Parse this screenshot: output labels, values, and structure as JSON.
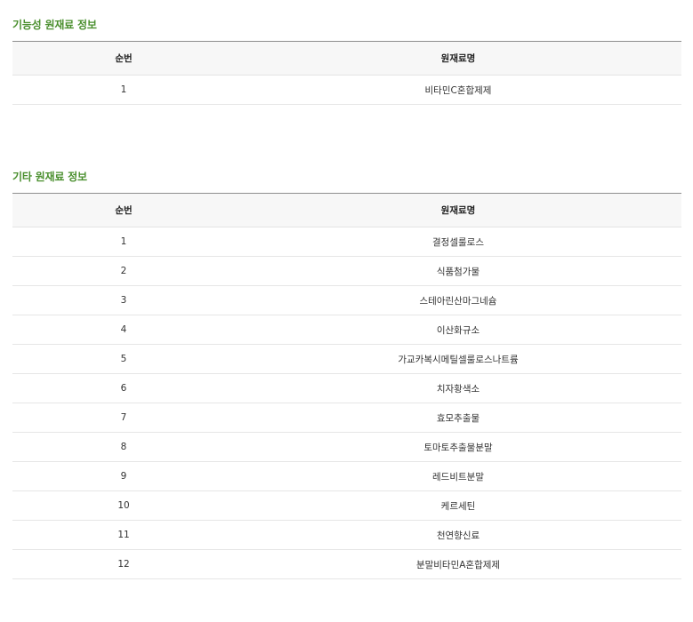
{
  "functional_section": {
    "title": "기능성 원재료 정보",
    "headers": {
      "seq": "순번",
      "name": "원재료명"
    },
    "rows": [
      {
        "seq": "1",
        "name": "비타민C혼합제제"
      }
    ]
  },
  "other_section": {
    "title": "기타 원재료 정보",
    "headers": {
      "seq": "순번",
      "name": "원재료명"
    },
    "rows": [
      {
        "seq": "1",
        "name": "결정셀룰로스"
      },
      {
        "seq": "2",
        "name": "식품첨가물"
      },
      {
        "seq": "3",
        "name": "스테아린산마그네슘"
      },
      {
        "seq": "4",
        "name": "이산화규소"
      },
      {
        "seq": "5",
        "name": "가교카복시메틸셀룰로스나트륨"
      },
      {
        "seq": "6",
        "name": "치자황색소"
      },
      {
        "seq": "7",
        "name": "효모추출물"
      },
      {
        "seq": "8",
        "name": "토마토추출물분말"
      },
      {
        "seq": "9",
        "name": "레드비트분말"
      },
      {
        "seq": "10",
        "name": "케르세틴"
      },
      {
        "seq": "11",
        "name": "천연향신료"
      },
      {
        "seq": "12",
        "name": "분말비타민A혼합제제"
      }
    ]
  },
  "colors": {
    "section_title": "#4a8f2e",
    "header_background": "#f7f7f7",
    "header_top_border": "#8e8e8e",
    "row_border": "#e6e6e6"
  }
}
